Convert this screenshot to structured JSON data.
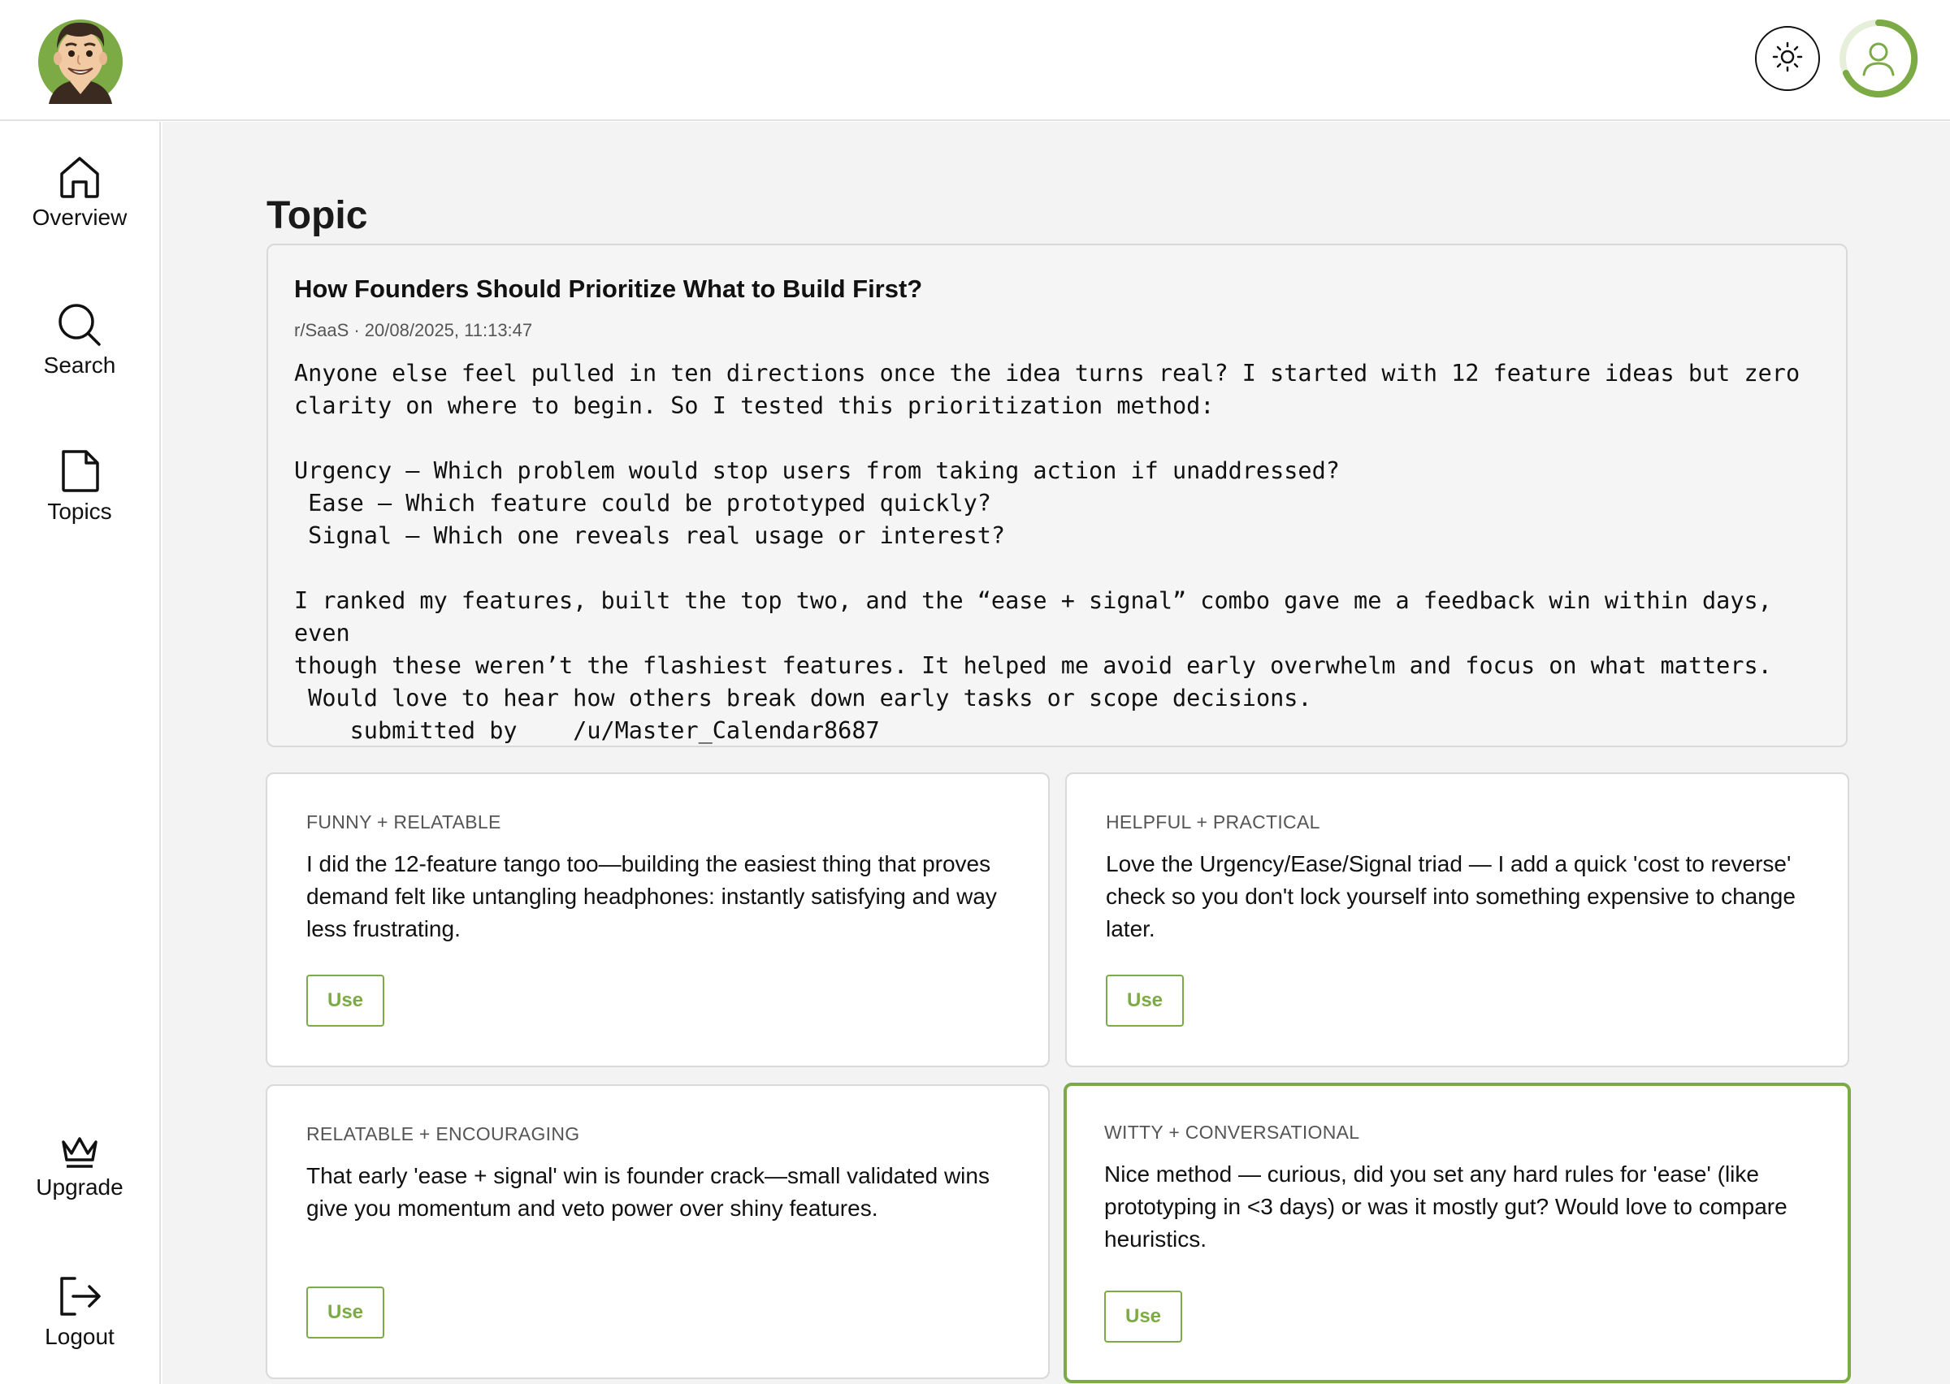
{
  "header": {
    "logo_icon": "cartoon-avatar-logo",
    "theme_icon": "sun-icon",
    "profile_icon": "user-icon",
    "accent_color": "#7cab45"
  },
  "sidebar": {
    "items": [
      {
        "label": "Overview",
        "icon": "home-icon"
      },
      {
        "label": "Search",
        "icon": "search-icon"
      },
      {
        "label": "Topics",
        "icon": "file-icon"
      }
    ],
    "bottom_items": [
      {
        "label": "Upgrade",
        "icon": "crown-icon"
      },
      {
        "label": "Logout",
        "icon": "logout-icon"
      }
    ]
  },
  "main": {
    "page_title": "Topic",
    "topic": {
      "title": "How Founders Should Prioritize What to Build First?",
      "meta": "r/SaaS · 20/08/2025, 11:13:47",
      "body": "Anyone else feel pulled in ten directions once the idea turns real? I started with 12 feature ideas but zero\nclarity on where to begin. So I tested this prioritization method:\n\nUrgency – Which problem would stop users from taking action if unaddressed?\n Ease – Which feature could be prototyped quickly?\n Signal – Which one reveals real usage or interest?\n\nI ranked my features, built the top two, and the “ease + signal” combo gave me a feedback win within days, even\nthough these weren’t the flashiest features. It helped me avoid early overwhelm and focus on what matters.\n Would love to hear how others break down early tasks or scope decisions.\n    submitted by    /u/Master_Calendar8687"
    },
    "replies": [
      {
        "tag": "FUNNY + RELATABLE",
        "text": "I did the 12-feature tango too—building the easiest thing that proves demand felt like untangling headphones: instantly satisfying and way less frustrating.",
        "button": "Use"
      },
      {
        "tag": "HELPFUL + PRACTICAL",
        "text": "Love the Urgency/Ease/Signal triad — I add a quick 'cost to reverse' check so you don't lock yourself into something expensive to change later.",
        "button": "Use"
      },
      {
        "tag": "RELATABLE + ENCOURAGING",
        "text": "That early 'ease + signal' win is founder crack—small validated wins give you momentum and veto power over shiny features.",
        "button": "Use"
      },
      {
        "tag": "WITTY + CONVERSATIONAL",
        "text": "Nice method — curious, did you set any hard rules for 'ease' (like prototyping in <3 days) or was it mostly gut? Would love to compare heuristics.",
        "button": "Use"
      }
    ]
  }
}
